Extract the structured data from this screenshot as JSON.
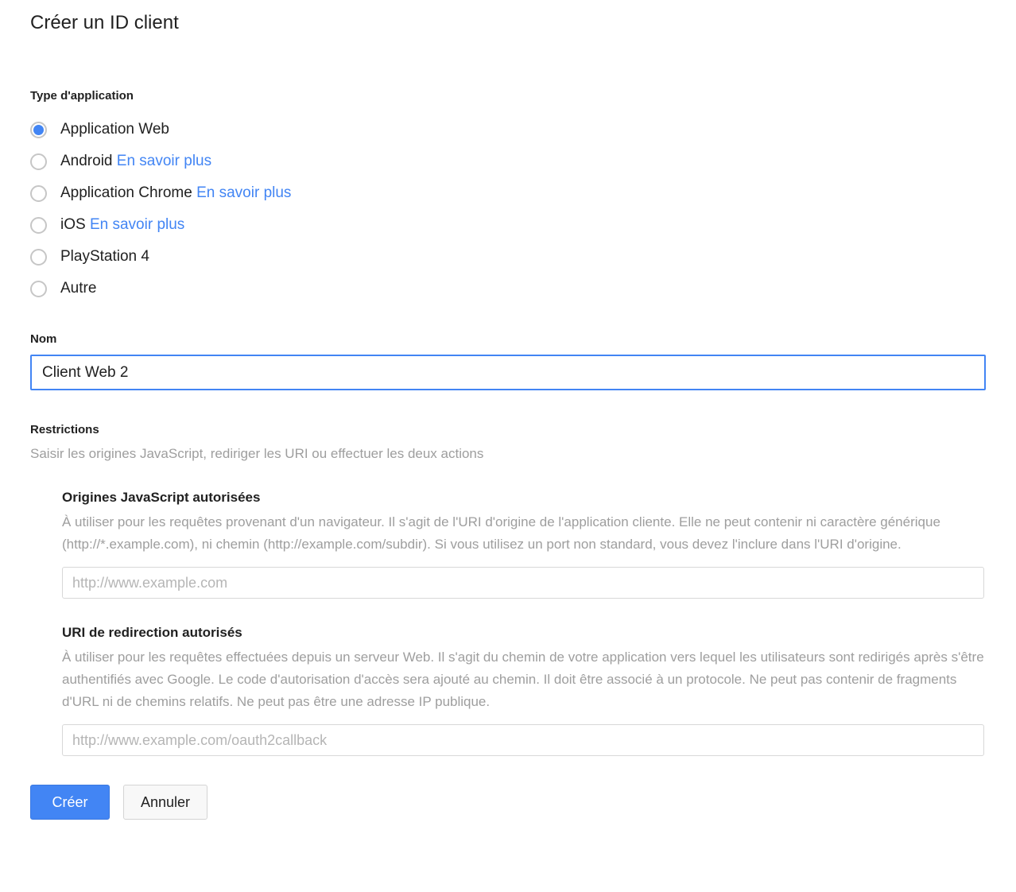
{
  "page": {
    "title": "Créer un ID client"
  },
  "application_type": {
    "label": "Type d'application",
    "selected": "Application Web",
    "options": [
      {
        "label": "Application Web",
        "link": "",
        "selected": true
      },
      {
        "label": "Android",
        "link": "En savoir plus",
        "selected": false
      },
      {
        "label": "Application Chrome",
        "link": "En savoir plus",
        "selected": false
      },
      {
        "label": "iOS",
        "link": "En savoir plus",
        "selected": false
      },
      {
        "label": "PlayStation 4",
        "link": "",
        "selected": false
      },
      {
        "label": "Autre",
        "link": "",
        "selected": false
      }
    ]
  },
  "name_field": {
    "label": "Nom",
    "value": "Client Web 2",
    "placeholder": ""
  },
  "restrictions": {
    "label": "Restrictions",
    "subtitle": "Saisir les origines JavaScript, rediriger les URI ou effectuer les deux actions",
    "javascript_origins": {
      "title": "Origines JavaScript autorisées",
      "description": "À utiliser pour les requêtes provenant d'un navigateur. Il s'agit de l'URI d'origine de l'application cliente. Elle ne peut contenir ni caractère générique (http://*.example.com), ni chemin (http://example.com/subdir). Si vous utilisez un port non standard, vous devez l'inclure dans l'URI d'origine.",
      "placeholder": "http://www.example.com",
      "value": ""
    },
    "redirect_uris": {
      "title": "URI de redirection autorisés",
      "description": "À utiliser pour les requêtes effectuées depuis un serveur Web. Il s'agit du chemin de votre application vers lequel les utilisateurs sont redirigés après s'être authentifiés avec Google. Le code d'autorisation d'accès sera ajouté au chemin. Il doit être associé à un protocole. Ne peut pas contenir de fragments d'URL ni de chemins relatifs. Ne peut pas être une adresse IP publique.",
      "placeholder": "http://www.example.com/oauth2callback",
      "value": ""
    }
  },
  "actions": {
    "create_label": "Créer",
    "cancel_label": "Annuler"
  },
  "colors": {
    "accent_blue": "#4285f4",
    "link_blue": "#4285f4",
    "text_primary": "#212121",
    "text_muted": "#9e9e9e",
    "border_grey": "#d8d8d8"
  }
}
